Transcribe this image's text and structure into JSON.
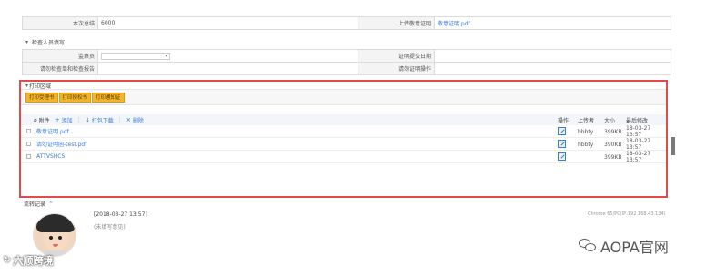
{
  "top_form": {
    "row1": {
      "label_left": "本次总结",
      "value_left": "6000",
      "label_right": "上传敬意证明",
      "value_right": "敬意证明.pdf"
    },
    "section_title": "检查人员填写",
    "row2": {
      "label_left": "监察员",
      "select_value": "▾",
      "label_right": "证明提交日期"
    },
    "row3": {
      "label_left": "请勿检查单和检查报告",
      "label_right": "请勿证明操作"
    }
  },
  "print_area": {
    "title": "打印区域",
    "buttons": [
      "打印受理书",
      "打印授权书",
      "打印通知证"
    ],
    "toolbar": {
      "attach": "附件",
      "add": "添加",
      "download": "打包下载",
      "delete": "删除"
    },
    "columns": {
      "op": "操作",
      "uploader": "上传者",
      "size": "大小",
      "modified": "最后修改"
    },
    "files": [
      {
        "name": "敬意证明.pdf",
        "uploader": "hbbty",
        "size": "399KB",
        "modified": "18-03-27 13:57"
      },
      {
        "name": "请勿证明函-test.pdf",
        "uploader": "hbbty",
        "size": "390KB",
        "modified": "18-03-27 13:57"
      },
      {
        "name": "ATTVSHCS",
        "uploader": "",
        "size": "399KB",
        "modified": "18-03-27 13:57"
      }
    ]
  },
  "flow": {
    "title": "流转记录",
    "date": "[2018-03-27 13:57]",
    "note": "(未填写意见)",
    "browser": "Chrome 65/PC(IP:192.168.43.134)"
  },
  "watermarks": {
    "left": "六顺跨境",
    "right": "AOPA官网"
  },
  "colors": {
    "highlight_border": "#e04b4b",
    "button": "#f3b42a",
    "link": "#3a7bd5"
  }
}
